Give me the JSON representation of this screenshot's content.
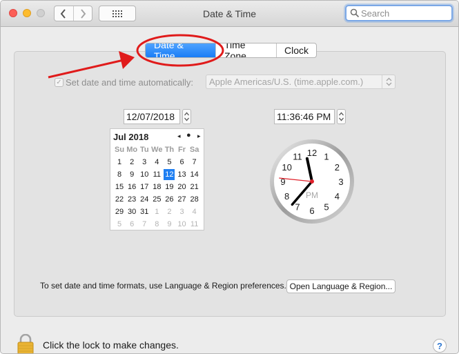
{
  "window": {
    "title": "Date & Time",
    "search_placeholder": "Search"
  },
  "tabs": [
    {
      "label": "Date & Time",
      "active": true
    },
    {
      "label": "Time Zone",
      "active": false
    },
    {
      "label": "Clock",
      "active": false
    }
  ],
  "auto_time": {
    "label": "Set date and time automatically:",
    "checked": true,
    "enabled": false,
    "server": "Apple Americas/U.S. (time.apple.com.)"
  },
  "date_field": "12/07/2018",
  "time_field": "11:36:46 PM",
  "calendar": {
    "month": "Jul 2018",
    "prev_symbol": "◂",
    "today_symbol": "●",
    "next_symbol": "▸",
    "weekdays": [
      "Su",
      "Mo",
      "Tu",
      "We",
      "Th",
      "Fr",
      "Sa"
    ],
    "weeks": [
      [
        "1",
        "2",
        "3",
        "4",
        "5",
        "6",
        "7"
      ],
      [
        "8",
        "9",
        "10",
        "11",
        "12",
        "13",
        "14"
      ],
      [
        "15",
        "16",
        "17",
        "18",
        "19",
        "20",
        "21"
      ],
      [
        "22",
        "23",
        "24",
        "25",
        "26",
        "27",
        "28"
      ],
      [
        "29",
        "30",
        "31",
        "1",
        "2",
        "3",
        "4"
      ],
      [
        "5",
        "6",
        "7",
        "8",
        "9",
        "10",
        "11"
      ]
    ],
    "selected_day": "12",
    "current_month_last_index": 30
  },
  "clock": {
    "numbers": [
      "12",
      "1",
      "2",
      "3",
      "4",
      "5",
      "6",
      "7",
      "8",
      "9",
      "10",
      "11"
    ],
    "period": "PM",
    "hour": 11,
    "minute": 36,
    "second": 46
  },
  "formats_text": "To set date and time formats, use Language & Region preferences.",
  "open_button_label": "Open Language & Region...",
  "lock_text": "Click the lock to make changes.",
  "help_label": "?",
  "colors": {
    "accent": "#1f7ff2",
    "annotation_red": "#e01b1b",
    "second_hand": "#e0202a"
  }
}
